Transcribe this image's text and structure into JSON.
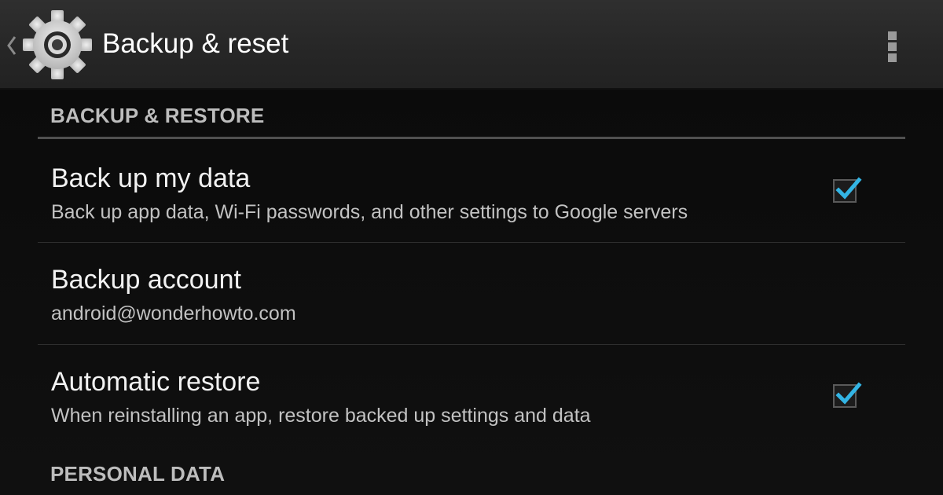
{
  "action_bar": {
    "title": "Backup & reset",
    "icons": {
      "up": "chevron-left-icon",
      "app": "settings-gear-icon",
      "overflow": "overflow-menu-icon"
    }
  },
  "sections": [
    {
      "header": "BACKUP & RESTORE",
      "items": [
        {
          "title": "Back up my data",
          "summary": "Back up app data, Wi-Fi passwords, and other settings to Google servers",
          "checked": true
        },
        {
          "title": "Backup account",
          "summary": "android@wonderhowto.com"
        },
        {
          "title": "Automatic restore",
          "summary": "When reinstalling an app, restore backed up settings and data",
          "checked": true
        }
      ]
    },
    {
      "header": "PERSONAL DATA"
    }
  ],
  "colors": {
    "accent": "#33b5e5",
    "action_bar": "#2a2a2a",
    "background": "#0d0d0d"
  }
}
